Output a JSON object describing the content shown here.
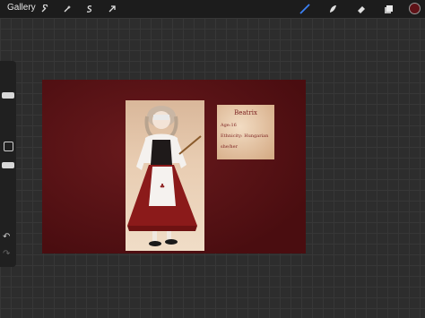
{
  "toolbar": {
    "gallery_label": "Gallery",
    "left_tools": [
      {
        "icon": "wrench-icon"
      },
      {
        "icon": "magic-wand-icon"
      },
      {
        "icon": "selection-icon"
      },
      {
        "icon": "transform-arrow-icon"
      }
    ],
    "right_tools": [
      {
        "icon": "brush-icon",
        "active": true,
        "color": "#3b82f6"
      },
      {
        "icon": "smudge-icon"
      },
      {
        "icon": "eraser-icon"
      },
      {
        "icon": "layers-icon"
      }
    ],
    "current_color": "#5e1217"
  },
  "canvas": {
    "card": {
      "title": "Beatrix",
      "lines": [
        "Age:16",
        "Ethnicity: Hungarian",
        "she/her"
      ]
    }
  }
}
